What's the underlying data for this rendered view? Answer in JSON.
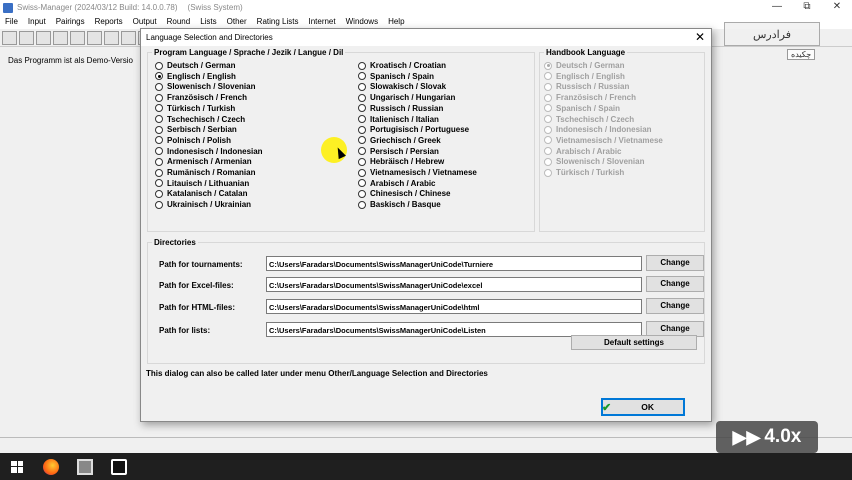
{
  "app": {
    "title": "Swiss-Manager (2024/03/12 Build: 14.0.0.78)",
    "subtitle": "(Swiss System)",
    "demo_text": "Das Programm ist als Demo-Versio"
  },
  "window_controls": [
    "—",
    "⧉",
    "✕"
  ],
  "menu": [
    "File",
    "Input",
    "Pairings",
    "Reports",
    "Output",
    "Round",
    "Lists",
    "Other",
    "Rating Lists",
    "Internet",
    "Windows",
    "Help"
  ],
  "watermark": {
    "brand": "فرادرس",
    "sub": "چکیده"
  },
  "speed_badge": "4.0x",
  "dialog": {
    "title": "Language Selection and Directories",
    "close": "✕",
    "program_language": {
      "label": "Program Language / Sprache / Jezik / Langue / Dil",
      "col1": [
        {
          "label": "Deutsch / German",
          "checked": false
        },
        {
          "label": "Englisch / English",
          "checked": true
        },
        {
          "label": "Slowenisch / Slovenian",
          "checked": false
        },
        {
          "label": "Französisch / French",
          "checked": false
        },
        {
          "label": "Türkisch / Turkish",
          "checked": false
        },
        {
          "label": "Tschechisch / Czech",
          "checked": false
        },
        {
          "label": "Serbisch / Serbian",
          "checked": false
        },
        {
          "label": "Polnisch / Polish",
          "checked": false
        },
        {
          "label": "Indonesisch / Indonesian",
          "checked": false
        },
        {
          "label": "Armenisch / Armenian",
          "checked": false
        },
        {
          "label": "Rumänisch / Romanian",
          "checked": false
        },
        {
          "label": "Litauisch / Lithuanian",
          "checked": false
        },
        {
          "label": "Katalanisch / Catalan",
          "checked": false
        },
        {
          "label": "Ukrainisch / Ukrainian",
          "checked": false
        }
      ],
      "col2": [
        {
          "label": "Kroatisch / Croatian",
          "checked": false
        },
        {
          "label": "Spanisch / Spain",
          "checked": false
        },
        {
          "label": "Slowakisch / Slovak",
          "checked": false
        },
        {
          "label": "Ungarisch / Hungarian",
          "checked": false
        },
        {
          "label": "Russisch / Russian",
          "checked": false
        },
        {
          "label": "Italienisch / Italian",
          "checked": false
        },
        {
          "label": "Portugisisch / Portuguese",
          "checked": false
        },
        {
          "label": "Griechisch / Greek",
          "checked": false
        },
        {
          "label": "Persisch / Persian",
          "checked": false
        },
        {
          "label": "Hebräisch / Hebrew",
          "checked": false
        },
        {
          "label": "Vietnamesisch / Vietnamese",
          "checked": false
        },
        {
          "label": "Arabisch / Arabic",
          "checked": false
        },
        {
          "label": "Chinesisch / Chinese",
          "checked": false
        },
        {
          "label": "Baskisch / Basque",
          "checked": false
        }
      ]
    },
    "handbook_language": {
      "label": "Handbook Language",
      "items": [
        {
          "label": "Deutsch / German",
          "checked": true
        },
        {
          "label": "Englisch / English",
          "checked": false
        },
        {
          "label": "Russisch / Russian",
          "checked": false
        },
        {
          "label": "Französisch / French",
          "checked": false
        },
        {
          "label": "Spanisch / Spain",
          "checked": false
        },
        {
          "label": "Tschechisch / Czech",
          "checked": false
        },
        {
          "label": "Indonesisch / Indonesian",
          "checked": false
        },
        {
          "label": "Vietnamesisch / Vietnamese",
          "checked": false
        },
        {
          "label": "Arabisch / Arabic",
          "checked": false
        },
        {
          "label": "Slowenisch / Slovenian",
          "checked": false
        },
        {
          "label": "Türkisch / Turkish",
          "checked": false
        }
      ]
    },
    "directories": {
      "label": "Directories",
      "rows": [
        {
          "label": "Path for tournaments:",
          "value": "C:\\Users\\Faradars\\Documents\\SwissManagerUniCode\\Turniere",
          "button": "Change"
        },
        {
          "label": "Path for Excel-files:",
          "value": "C:\\Users\\Faradars\\Documents\\SwissManagerUniCode\\excel",
          "button": "Change"
        },
        {
          "label": "Path for HTML-files:",
          "value": "C:\\Users\\Faradars\\Documents\\SwissManagerUniCode\\html",
          "button": "Change"
        },
        {
          "label": "Path for lists:",
          "value": "C:\\Users\\Faradars\\Documents\\SwissManagerUniCode\\Listen",
          "button": "Change"
        }
      ],
      "default_button": "Default settings"
    },
    "info": "This dialog can also be called later under menu Other/Language Selection and Directories",
    "ok_button": "OK"
  }
}
